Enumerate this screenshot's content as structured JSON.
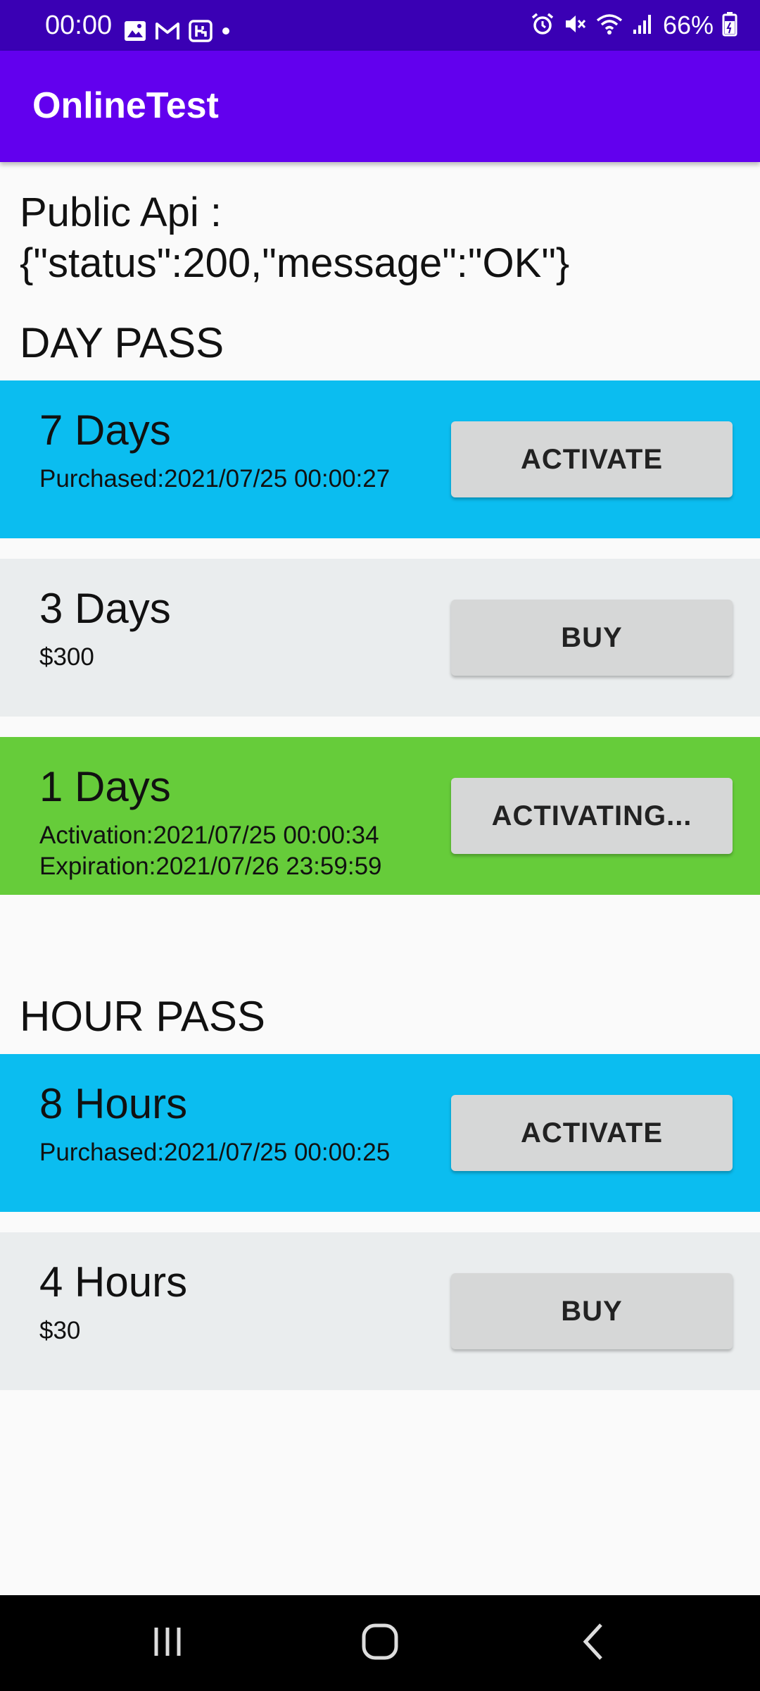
{
  "status_bar": {
    "time": "00:00",
    "battery": "66%",
    "left_icons": [
      "image-icon",
      "gmail-icon",
      "app-icon",
      "dot-icon"
    ],
    "right_icons": [
      "alarm-icon",
      "mute-icon",
      "wifi-icon",
      "signal-icon",
      "battery-icon"
    ]
  },
  "app_bar": {
    "title": "OnlineTest"
  },
  "api": {
    "line1": "Public Api :",
    "line2": "{\"status\":200,\"message\":\"OK\"}"
  },
  "day_pass": {
    "title": "DAY PASS",
    "items": [
      {
        "title": "7 Days",
        "detail": "Purchased:2021/07/25 00:00:27",
        "button": "ACTIVATE",
        "bg": "#0bbdf0"
      },
      {
        "title": "3 Days",
        "detail": "$300",
        "button": "BUY",
        "bg": "#eaedee"
      },
      {
        "title": "1 Days",
        "detail": "Activation:2021/07/25 00:00:34",
        "detail2": "Expiration:2021/07/26 23:59:59",
        "button": "ACTIVATING...",
        "bg": "#66cc3a"
      }
    ]
  },
  "hour_pass": {
    "title": "HOUR PASS",
    "items": [
      {
        "title": "8 Hours",
        "detail": "Purchased:2021/07/25 00:00:25",
        "button": "ACTIVATE",
        "bg": "#0bbdf0"
      },
      {
        "title": "4 Hours",
        "detail": "$30",
        "button": "BUY",
        "bg": "#eaedee"
      }
    ]
  },
  "nav_bar": {
    "buttons": [
      "recents-icon",
      "home-icon",
      "back-icon"
    ]
  }
}
